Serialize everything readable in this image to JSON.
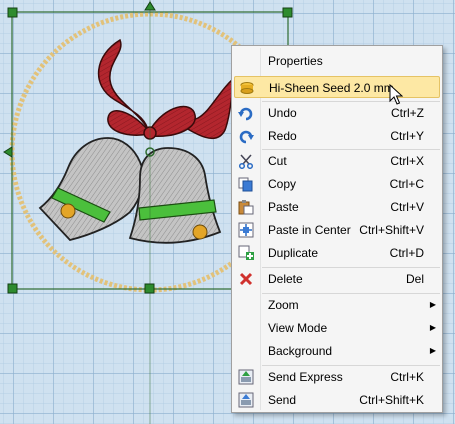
{
  "menu": {
    "items": [
      {
        "label": "Properties",
        "shortcut": "",
        "icon": "none",
        "submenu": false
      },
      {
        "label": "Hi-Sheen Seed 2.0 mm",
        "shortcut": "",
        "icon": "bead-icon",
        "submenu": false,
        "highlighted": true
      },
      {
        "label": "Undo",
        "shortcut": "Ctrl+Z",
        "icon": "undo-icon",
        "submenu": false
      },
      {
        "label": "Redo",
        "shortcut": "Ctrl+Y",
        "icon": "redo-icon",
        "submenu": false
      },
      {
        "label": "Cut",
        "shortcut": "Ctrl+X",
        "icon": "scissors-icon",
        "submenu": false
      },
      {
        "label": "Copy",
        "shortcut": "Ctrl+C",
        "icon": "copy-icon",
        "submenu": false
      },
      {
        "label": "Paste",
        "shortcut": "Ctrl+V",
        "icon": "paste-icon",
        "submenu": false
      },
      {
        "label": "Paste in Center",
        "shortcut": "Ctrl+Shift+V",
        "icon": "paste-center-icon",
        "submenu": false
      },
      {
        "label": "Duplicate",
        "shortcut": "Ctrl+D",
        "icon": "duplicate-icon",
        "submenu": false
      },
      {
        "label": "Delete",
        "shortcut": "Del",
        "icon": "delete-x-icon",
        "submenu": false
      },
      {
        "label": "Zoom",
        "shortcut": "",
        "icon": "none",
        "submenu": true
      },
      {
        "label": "View Mode",
        "shortcut": "",
        "icon": "none",
        "submenu": true
      },
      {
        "label": "Background",
        "shortcut": "",
        "icon": "none",
        "submenu": true
      },
      {
        "label": "Send Express",
        "shortcut": "Ctrl+K",
        "icon": "send-express-icon",
        "submenu": false
      },
      {
        "label": "Send",
        "shortcut": "Ctrl+Shift+K",
        "icon": "send-icon",
        "submenu": false
      }
    ]
  },
  "colors": {
    "grid_background": "#cfe1f0",
    "selection_frame": "#2e6b2e",
    "ribbon_red": "#b3262e",
    "bell_silver": "#b9b9b9",
    "bead_gold": "#e2c27a",
    "menu_highlight": "#fde8a4"
  }
}
